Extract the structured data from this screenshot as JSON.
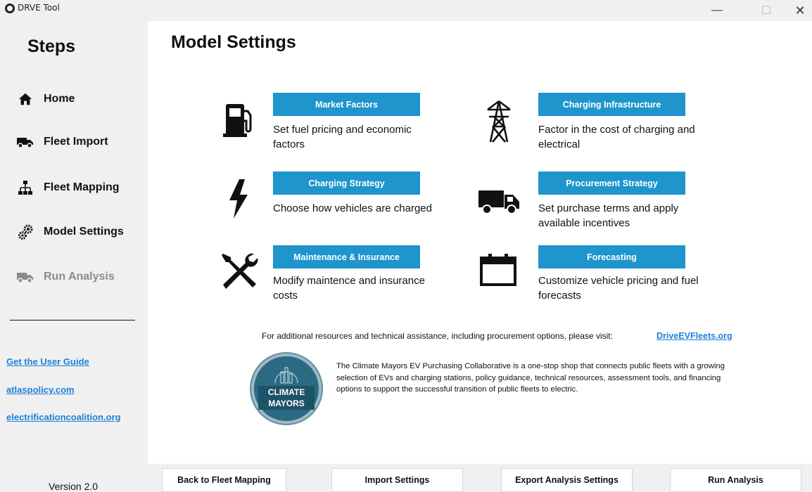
{
  "window": {
    "title": "DRVE Tool",
    "minimize": "—",
    "maximize": "☐",
    "close": "✕"
  },
  "sidebar": {
    "heading": "Steps",
    "items": [
      {
        "label": "Home",
        "icon": "home-icon"
      },
      {
        "label": "Fleet Import",
        "icon": "truck-icon"
      },
      {
        "label": "Fleet Mapping",
        "icon": "hierarchy-icon"
      },
      {
        "label": "Model Settings",
        "icon": "gears-icon"
      },
      {
        "label": "Run Analysis",
        "icon": "truck-icon",
        "disabled": true
      }
    ],
    "links": [
      "Get the User Guide",
      "atlaspolicy.com",
      "electrificationcoalition.org"
    ],
    "version": "Version 2.0"
  },
  "main": {
    "title": "Model Settings",
    "tiles": [
      {
        "button": "Market Factors",
        "desc": "Set fuel pricing and economic factors",
        "icon": "fuel-pump-icon"
      },
      {
        "button": "Charging Infrastructure",
        "desc": "Factor in the cost of charging and electrical",
        "icon": "power-tower-icon"
      },
      {
        "button": "Charging Strategy",
        "desc": "Choose how vehicles are charged",
        "icon": "lightning-icon"
      },
      {
        "button": "Procurement Strategy",
        "desc": "Set purchase terms and apply available incentives",
        "icon": "truck-icon"
      },
      {
        "button": "Maintenance & Insurance",
        "desc": "Modify maintence and insurance costs",
        "icon": "tools-icon"
      },
      {
        "button": "Forecasting",
        "desc": "Customize vehicle pricing and fuel forecasts",
        "icon": "calendar-icon"
      }
    ],
    "resources_text": "For additional resources and technical assistance, including procurement options, please visit:",
    "resources_link": "DriveEVFleets.org",
    "logo_line1": "CLIMATE",
    "logo_line2": "MAYORS",
    "collab_text": "The Climate Mayors EV Purchasing Collaborative is a one-stop shop that connects public fleets with a growing selection of EVs and charging stations, policy guidance, technical resources, assessment tools, and financing options to support the successful transition of public fleets to electric."
  },
  "footer": {
    "back": "Back to Fleet Mapping",
    "import": "Import Settings",
    "export": "Export Analysis Settings",
    "run": "Run Analysis"
  },
  "colors": {
    "accent": "#1e95cc",
    "link": "#1f7fd6",
    "disabled": "#8a8a8a"
  }
}
